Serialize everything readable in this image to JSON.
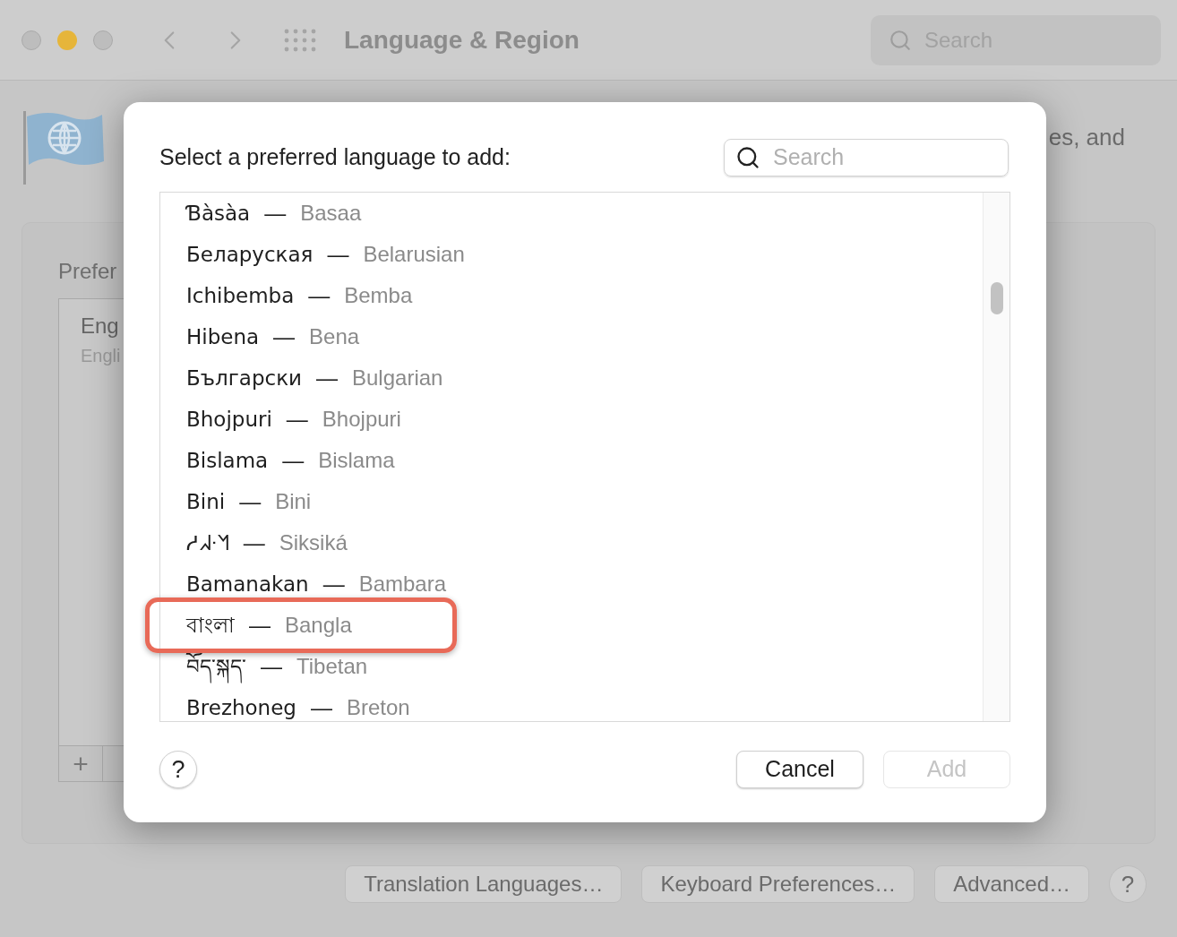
{
  "window": {
    "title": "Language & Region",
    "search_placeholder": "Search"
  },
  "background": {
    "description_fragment": "es, and",
    "section_label": "Prefer",
    "list": [
      {
        "name": "Eng",
        "subtitle": "Engli"
      }
    ],
    "add_button": "+"
  },
  "bottom_buttons": [
    "Translation Languages…",
    "Keyboard Preferences…",
    "Advanced…"
  ],
  "bottom_help": "?",
  "dialog": {
    "prompt": "Select a preferred language to add:",
    "search_placeholder": "Search",
    "languages": [
      {
        "native": "Ɓàsàa",
        "english": "Basaa",
        "highlighted": false
      },
      {
        "native": "Беларуская",
        "english": "Belarusian",
        "highlighted": false
      },
      {
        "native": "Ichibemba",
        "english": "Bemba",
        "highlighted": false
      },
      {
        "native": "Hibena",
        "english": "Bena",
        "highlighted": false
      },
      {
        "native": "Български",
        "english": "Bulgarian",
        "highlighted": false
      },
      {
        "native": "Bhojpuri",
        "english": "Bhojpuri",
        "highlighted": false
      },
      {
        "native": "Bislama",
        "english": "Bislama",
        "highlighted": false
      },
      {
        "native": "Bini",
        "english": "Bini",
        "highlighted": false
      },
      {
        "native": "ᓱᖽᐧᖿ",
        "english": "Siksiká",
        "highlighted": false
      },
      {
        "native": "Bamanakan",
        "english": "Bambara",
        "highlighted": false
      },
      {
        "native": "বাংলা",
        "english": "Bangla",
        "highlighted": true
      },
      {
        "native": "བོད་སྐད་",
        "english": "Tibetan",
        "highlighted": false
      },
      {
        "native": "Brezhoneg",
        "english": "Breton",
        "highlighted": false
      }
    ],
    "separator": "—",
    "help": "?",
    "buttons": [
      {
        "label": "Cancel",
        "disabled": false
      },
      {
        "label": "Add",
        "disabled": true
      }
    ]
  }
}
